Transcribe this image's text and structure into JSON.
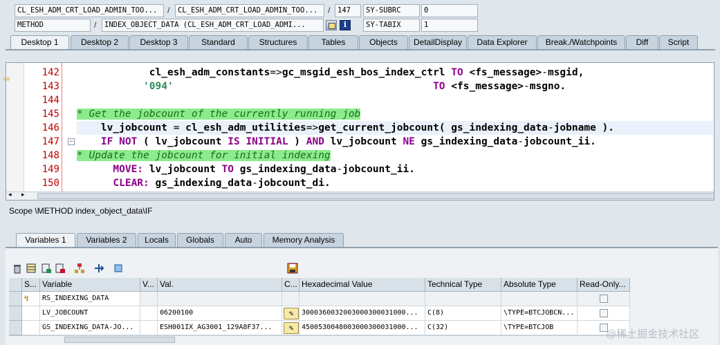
{
  "header": {
    "row1": {
      "program": "CL_ESH_ADM_CRT_LOAD_ADMIN_TOO...",
      "include": "CL_ESH_ADM_CRT_LOAD_ADMIN_TOO...",
      "line": "147",
      "sysfield": "SY-SUBRC",
      "sysvalue": "0"
    },
    "row2": {
      "event_type": "METHOD",
      "event": "INDEX_OBJECT_DATA (CL_ESH_ADM_CRT_LOAD_ADMI...",
      "sysfield": "SY-TABIX",
      "sysvalue": "1"
    },
    "separator": "/"
  },
  "desktop_tabs": [
    "Desktop 1",
    "Desktop 2",
    "Desktop 3",
    "Standard",
    "Structures",
    "Tables",
    "Objects",
    "DetailDisplay",
    "Data Explorer",
    "Break./Watchpoints",
    "Diff",
    "Script"
  ],
  "code": {
    "line_numbers": [
      "142",
      "143",
      "144",
      "145",
      "146",
      "147",
      "148",
      "149",
      "150"
    ],
    "lines": [
      [
        {
          "t": "            cl_esh_adm_constants",
          "c": "id"
        },
        {
          "t": "=>",
          "c": "op"
        },
        {
          "t": "gc_msgid_esh_bos_index_ctrl ",
          "c": "id"
        },
        {
          "t": "TO ",
          "c": "kw"
        },
        {
          "t": "<fs_message>",
          "c": "id"
        },
        {
          "t": "-",
          "c": "op"
        },
        {
          "t": "msgid,",
          "c": "id"
        }
      ],
      [
        {
          "t": "           ",
          "c": "op"
        },
        {
          "t": "'094'",
          "c": "str"
        },
        {
          "t": "                                           ",
          "c": "op"
        },
        {
          "t": "TO ",
          "c": "kw"
        },
        {
          "t": "<fs_message>",
          "c": "id"
        },
        {
          "t": "-",
          "c": "op"
        },
        {
          "t": "msgno.",
          "c": "id"
        }
      ],
      [],
      [
        {
          "t": "* Get the jobcount of the currently running job",
          "c": "cmt"
        }
      ],
      [
        {
          "t": "    lv_jobcount ",
          "c": "id"
        },
        {
          "t": "= ",
          "c": "op"
        },
        {
          "t": "cl_esh_adm_utilities",
          "c": "id"
        },
        {
          "t": "=>",
          "c": "op"
        },
        {
          "t": "get_current_jobcount( gs_indexing_data",
          "c": "id"
        },
        {
          "t": "-",
          "c": "op"
        },
        {
          "t": "jobname ).",
          "c": "id"
        }
      ],
      [
        {
          "t": "    ",
          "c": "op"
        },
        {
          "t": "IF NOT ",
          "c": "kw"
        },
        {
          "t": "( lv_jobcount ",
          "c": "id"
        },
        {
          "t": "IS INITIAL ",
          "c": "kw"
        },
        {
          "t": ") ",
          "c": "id"
        },
        {
          "t": "AND ",
          "c": "kw"
        },
        {
          "t": "lv_jobcount ",
          "c": "id"
        },
        {
          "t": "NE ",
          "c": "kw"
        },
        {
          "t": "gs_indexing_data",
          "c": "id"
        },
        {
          "t": "-",
          "c": "op"
        },
        {
          "t": "jobcount_ii.",
          "c": "id"
        }
      ],
      [
        {
          "t": "* Update the jobcount for initial indexing",
          "c": "cmt"
        }
      ],
      [
        {
          "t": "      ",
          "c": "op"
        },
        {
          "t": "MOVE: ",
          "c": "kw"
        },
        {
          "t": "lv_jobcount ",
          "c": "id"
        },
        {
          "t": "TO ",
          "c": "kw"
        },
        {
          "t": "gs_indexing_data",
          "c": "id"
        },
        {
          "t": "-",
          "c": "op"
        },
        {
          "t": "jobcount_ii.",
          "c": "id"
        }
      ],
      [
        {
          "t": "      ",
          "c": "op"
        },
        {
          "t": "CLEAR: ",
          "c": "kw"
        },
        {
          "t": "gs_indexing_data",
          "c": "id"
        },
        {
          "t": "-",
          "c": "op"
        },
        {
          "t": "jobcount_di.",
          "c": "id"
        }
      ]
    ]
  },
  "scope_text": "Scope \\METHOD index_object_data\\IF",
  "variable_tabs": [
    "Variables 1",
    "Variables 2",
    "Locals",
    "Globals",
    "Auto",
    "Memory Analysis"
  ],
  "grid": {
    "columns": [
      "S...",
      "Variable",
      "V...",
      "Val.",
      "C...",
      "Hexadecimal Value",
      "Technical Type",
      "Absolute Type",
      "Read-Only..."
    ],
    "rows": [
      {
        "variable": "RS_INDEXING_DATA",
        "value": "",
        "hex": "",
        "tech": "",
        "abs": ""
      },
      {
        "variable": "LV_JOBCOUNT",
        "value": "06200100",
        "hex": "3000360032003000300031000...",
        "tech": "C(8)",
        "abs": "\\TYPE=BTCJOBCN..."
      },
      {
        "variable": "GS_INDEXING_DATA-JO...",
        "value": "ESH001IX_AG3001_129A8F37...",
        "hex": "4500530048003000300031000...",
        "tech": "C(32)",
        "abs": "\\TYPE=BTCJOB"
      }
    ]
  },
  "watermark": "@稀土掘金技术社区"
}
